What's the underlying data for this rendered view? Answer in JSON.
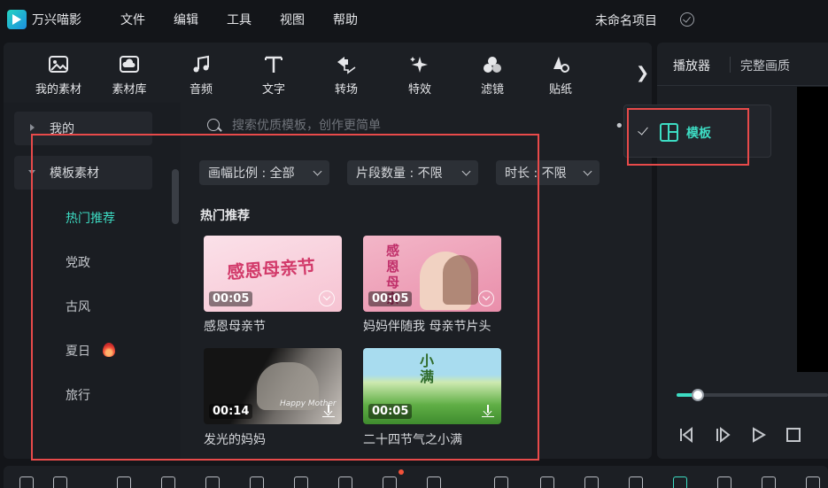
{
  "app": {
    "name": "万兴喵影",
    "project_title": "未命名项目"
  },
  "menu": [
    "文件",
    "编辑",
    "工具",
    "视图",
    "帮助"
  ],
  "toolbar": {
    "items": [
      {
        "label": "我的素材",
        "icon": "image-icon"
      },
      {
        "label": "素材库",
        "icon": "cloud-library-icon"
      },
      {
        "label": "音频",
        "icon": "music-note-icon"
      },
      {
        "label": "文字",
        "icon": "text-icon"
      },
      {
        "label": "转场",
        "icon": "transition-icon"
      },
      {
        "label": "特效",
        "icon": "sparkle-icon"
      },
      {
        "label": "滤镜",
        "icon": "filter-icon"
      },
      {
        "label": "贴纸",
        "icon": "sticker-icon"
      }
    ],
    "more": "❯"
  },
  "sidebar": {
    "group_mine": "我的",
    "group_templates": "模板素材",
    "items": [
      {
        "label": "热门推荐",
        "active": true
      },
      {
        "label": "党政",
        "active": false
      },
      {
        "label": "古风",
        "active": false
      },
      {
        "label": "夏日",
        "active": false,
        "hot": true
      },
      {
        "label": "旅行",
        "active": false
      }
    ],
    "collapse": "‹"
  },
  "search": {
    "placeholder": "搜索优质模板，创作更简单"
  },
  "filters": [
    {
      "label": "画幅比例 : 全部"
    },
    {
      "label": "片段数量 : 不限"
    },
    {
      "label": "时长 : 不限"
    }
  ],
  "section_title": "热门推荐",
  "templates": [
    {
      "title": "感恩母亲节",
      "duration": "00:05",
      "art": "感恩母亲节"
    },
    {
      "title": "妈妈伴随我 母亲节片头",
      "duration": "00:05",
      "art": "感恩母亲"
    },
    {
      "title": "发光的妈妈",
      "duration": "00:14",
      "art": "Happy Mother"
    },
    {
      "title": "二十四节气之小满",
      "duration": "00:05",
      "art": "小满"
    }
  ],
  "player": {
    "tab": "播放器",
    "quality": "完整画质",
    "progress": 0.14
  },
  "dropdown": {
    "label": "模板",
    "selected": true
  },
  "colors": {
    "accent": "#3ddcc3",
    "annotation": "#e84a4a",
    "background": "#131519",
    "panel": "#1c1f24"
  }
}
